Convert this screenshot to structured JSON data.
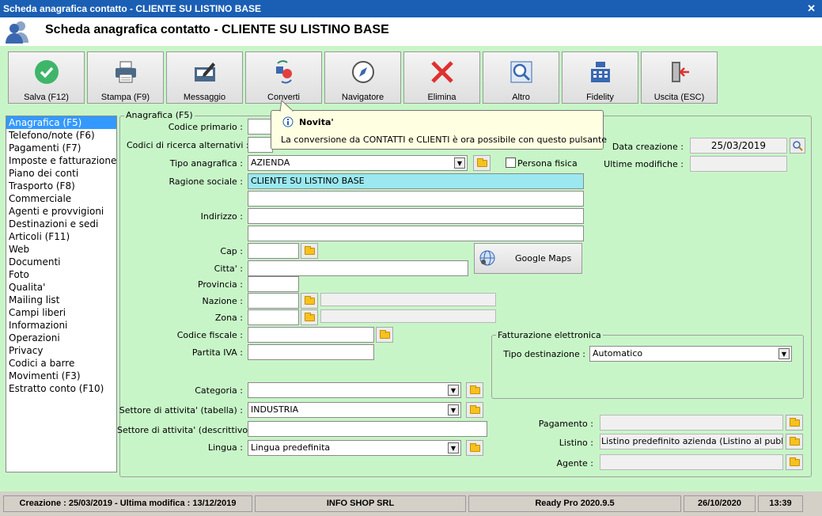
{
  "window": {
    "title": "Scheda anagrafica contatto - CLIENTE SU LISTINO BASE",
    "header_title": "Scheda anagrafica contatto - CLIENTE SU LISTINO BASE"
  },
  "toolbar": {
    "items": [
      {
        "label": "Salva (F12)",
        "icon": "check-icon"
      },
      {
        "label": "Stampa (F9)",
        "icon": "printer-icon"
      },
      {
        "label": "Messaggio",
        "icon": "message-icon"
      },
      {
        "label": "Converti",
        "icon": "convert-icon"
      },
      {
        "label": "Navigatore",
        "icon": "compass-icon"
      },
      {
        "label": "Elimina",
        "icon": "delete-icon"
      },
      {
        "label": "Altro",
        "icon": "magnifier-icon"
      },
      {
        "label": "Fidelity",
        "icon": "cash-register-icon"
      },
      {
        "label": "Uscita (ESC)",
        "icon": "exit-icon"
      }
    ]
  },
  "tooltip": {
    "title": "Novita'",
    "text": "La conversione da CONTATTI e CLIENTI è ora possibile con questo pulsante"
  },
  "nav": {
    "items": [
      "Anagrafica (F5)",
      "Telefono/note (F6)",
      "Pagamenti (F7)",
      "Imposte e fatturazione",
      "Piano dei conti",
      "Trasporto (F8)",
      "Commerciale",
      "Agenti e provvigioni",
      "Destinazioni e sedi",
      "Articoli (F11)",
      "Web",
      "Documenti",
      "Foto",
      "Qualita'",
      "Mailing list",
      "Campi liberi",
      "Informazioni",
      "Operazioni",
      "Privacy",
      "Codici a barre",
      "Movimenti (F3)",
      "Estratto conto (F10)"
    ],
    "selected": "Anagrafica (F5)"
  },
  "form": {
    "group_title": "Anagrafica (F5)",
    "codice_primario": {
      "label": "Codice primario :",
      "value": ""
    },
    "codici_ricerca": {
      "label": "Codici di ricerca alternativi :",
      "value": ""
    },
    "tipo_anagrafica": {
      "label": "Tipo anagrafica :",
      "value": "AZIENDA"
    },
    "persona_fisica": {
      "label": "Persona fisica",
      "checked": false
    },
    "ragione_sociale": {
      "label": "Ragione sociale :",
      "value": "CLIENTE SU LISTINO BASE"
    },
    "indirizzo": {
      "label": "Indirizzo :",
      "value": ""
    },
    "cap": {
      "label": "Cap :",
      "value": ""
    },
    "citta": {
      "label": "Citta' :",
      "value": ""
    },
    "provincia": {
      "label": "Provincia :",
      "value": ""
    },
    "nazione": {
      "label": "Nazione :",
      "value": ""
    },
    "zona": {
      "label": "Zona :",
      "value": ""
    },
    "codice_fiscale": {
      "label": "Codice fiscale :",
      "value": ""
    },
    "partita_iva": {
      "label": "Partita IVA :",
      "value": ""
    },
    "categoria": {
      "label": "Categoria :",
      "value": ""
    },
    "settore_tabella": {
      "label": "Settore di attivita' (tabella) :",
      "value": "INDUSTRIA"
    },
    "settore_descrittivo": {
      "label": "Settore di attivita' (descrittivo) :",
      "value": ""
    },
    "lingua": {
      "label": "Lingua :",
      "value": "Lingua predefinita"
    },
    "google_maps": "Google Maps",
    "data_creazione": {
      "label": "Data creazione :",
      "value": "25/03/2019"
    },
    "ultime_modifiche": {
      "label": "Ultime modifiche :",
      "value": ""
    },
    "fatturazione": {
      "title": "Fatturazione elettronica",
      "tipo_label": "Tipo destinazione :",
      "tipo_value": "Automatico"
    },
    "pagamento": {
      "label": "Pagamento :",
      "value": ""
    },
    "listino": {
      "label": "Listino :",
      "value": "Listino predefinito azienda (Listino al pubblico)"
    },
    "agente": {
      "label": "Agente :",
      "value": ""
    }
  },
  "status": {
    "creation": "Creazione : 25/03/2019 - Ultima modifica : 13/12/2019",
    "company": "INFO SHOP SRL",
    "version": "Ready Pro 2020.9.5",
    "date": "26/10/2020",
    "time": "13:39"
  }
}
